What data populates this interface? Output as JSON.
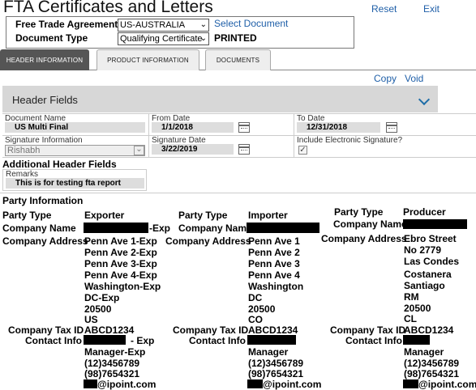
{
  "page": {
    "title": "FTA Certificates and Letters",
    "reset_label": "Reset",
    "exit_label": "Exit"
  },
  "agreement": {
    "fta_label": "Free Trade Agreement",
    "fta_value": "US-AUSTRALIA",
    "select_document_label": "Select Document",
    "doc_type_label": "Document Type",
    "doc_type_value": "Qualifying Certificate",
    "status": "PRINTED"
  },
  "tabs": [
    {
      "label": "HEADER INFORMATION",
      "active": true
    },
    {
      "label": "PRODUCT INFORMATION",
      "active": false
    },
    {
      "label": "DOCUMENTS",
      "active": false
    }
  ],
  "actions": {
    "copy_label": "Copy",
    "void_label": "Void"
  },
  "header_fields": {
    "title": "Header Fields",
    "document_name_label": "Document Name",
    "document_name": "US Multi Final",
    "from_date_label": "From Date",
    "from_date": "1/1/2018",
    "to_date_label": "To Date",
    "to_date": "12/31/2018",
    "signature_info_label": "Signature Information",
    "signature_info": "Rishabh",
    "signature_date_label": "Signature Date",
    "signature_date": "3/22/2019",
    "include_esig_label": "Include Electronic Signature?",
    "include_esig_checked": true
  },
  "additional": {
    "title": "Additional Header Fields",
    "remarks_label": "Remarks",
    "remarks": "This is for testing fta report"
  },
  "party": {
    "title": "Party Information",
    "labels": {
      "party_type": "Party Type",
      "company_name": "Company Name",
      "company_address": "Company Address",
      "tax_id": "Company Tax ID",
      "contact_info": "Contact Info"
    },
    "exporter": {
      "type": "Exporter",
      "name_suffix": "-Exp",
      "address": [
        "Penn Ave 1-Exp",
        "Penn Ave 2-Exp",
        "Penn Ave 3-Exp",
        "Penn Ave 4-Exp",
        "Washington-Exp",
        "DC-Exp",
        "20500",
        "US"
      ],
      "tax_id": "ABCD1234",
      "contact_suffix": "- Exp",
      "contact_lines": [
        "Manager-Exp",
        "(12)3456789",
        "(98)7654321"
      ],
      "email_domain": "@ipoint.com"
    },
    "importer": {
      "type": "Importer",
      "address": [
        "Penn Ave 1",
        "Penn Ave 2",
        "Penn Ave 3",
        "Penn Ave 4",
        "Washington",
        "DC",
        "20500",
        "CO"
      ],
      "tax_id": "ABCD1234",
      "contact_lines": [
        "Manager",
        "(12)3456789",
        "(98)7654321"
      ],
      "email_domain": "@ipoint.com"
    },
    "producer": {
      "type": "Producer",
      "address": [
        "Ebro Street",
        "No 2779",
        "Las Condes",
        "Costanera",
        "Santiago",
        "RM",
        "20500",
        "CL"
      ],
      "tax_id": "ABCD1234",
      "contact_lines": [
        "Manager",
        "(12)3456789",
        "(98)7654321"
      ],
      "email_domain": "@ipoint.com"
    }
  }
}
